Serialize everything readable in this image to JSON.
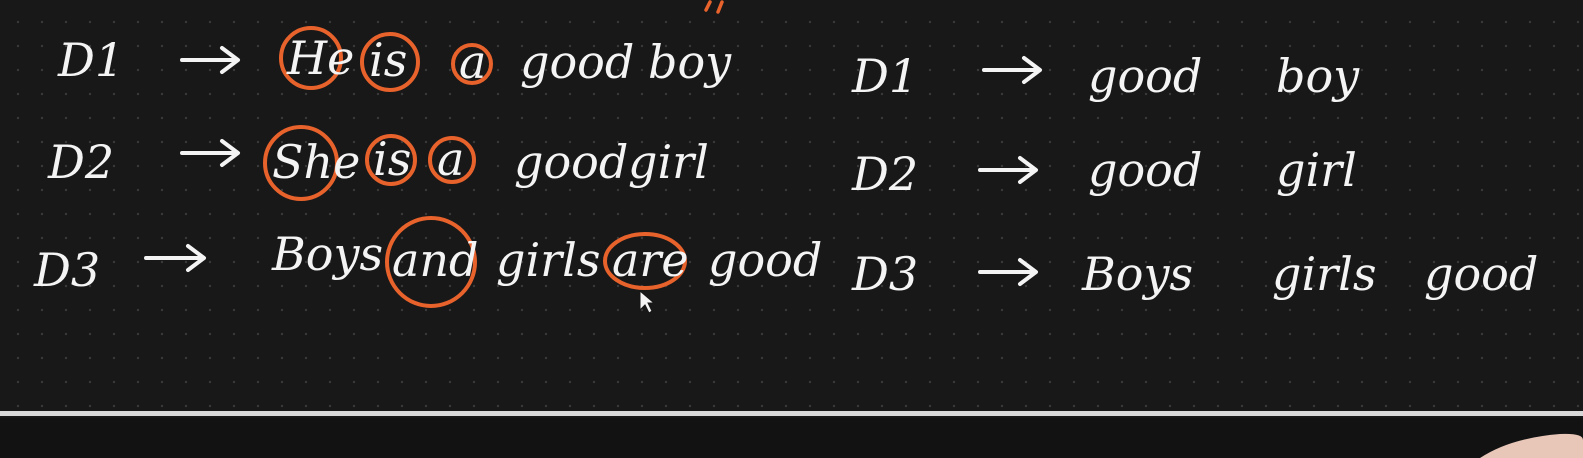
{
  "left_panel": {
    "rows": [
      {
        "label": "D1",
        "words": [
          "He",
          "is",
          "a",
          "good",
          "boy"
        ]
      },
      {
        "label": "D2",
        "words": [
          "She",
          "is",
          "a",
          "good",
          "girl"
        ]
      },
      {
        "label": "D3",
        "words": [
          "Boys",
          "and",
          "girls",
          "are",
          "good"
        ]
      }
    ]
  },
  "right_panel": {
    "rows": [
      {
        "label": "D1",
        "words": [
          "good",
          "boy"
        ]
      },
      {
        "label": "D2",
        "words": [
          "good",
          "girl"
        ]
      },
      {
        "label": "D3",
        "words": [
          "Boys",
          "girls",
          "good"
        ]
      }
    ]
  },
  "colors": {
    "ink": "#f4f4f4",
    "highlight": "#e8622c",
    "background": "#181818"
  },
  "icons": {
    "arrow": "right-arrow-icon",
    "cursor": "mouse-pointer-icon"
  }
}
